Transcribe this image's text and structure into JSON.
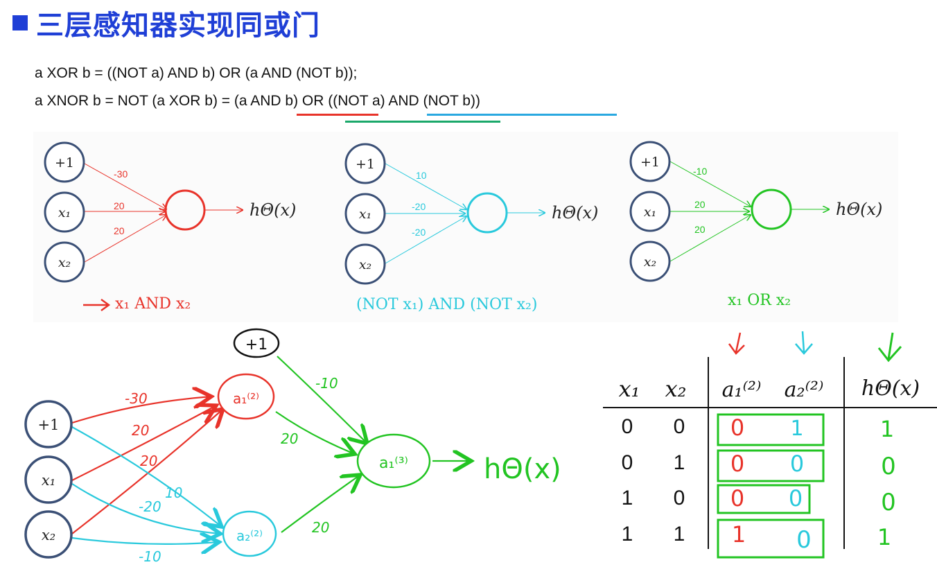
{
  "title": "三层感知器实现同或门",
  "equations": {
    "xor": "a XOR b = ((NOT a) AND b) OR (a AND (NOT b));",
    "xnor": "a XNOR b = NOT (a XOR b) = (a AND b) OR ((NOT a) AND (NOT b))"
  },
  "colors": {
    "title": "#1f3fd6",
    "red": "#e8332a",
    "cyan": "#29c9dc",
    "green": "#22c422",
    "node": "#3b5076"
  },
  "panels": [
    {
      "nodes": [
        "+1",
        "x₁",
        "x₂"
      ],
      "weights": [
        "-30",
        "20",
        "20"
      ],
      "output": "hΘ(x)",
      "caption": "x₁ AND x₂",
      "color": "#e8332a"
    },
    {
      "nodes": [
        "+1",
        "x₁",
        "x₂"
      ],
      "weights": [
        "10",
        "-20",
        "-20"
      ],
      "output": "hΘ(x)",
      "caption": "(NOT x₁) AND (NOT x₂)",
      "color": "#29c9dc"
    },
    {
      "nodes": [
        "+1",
        "x₁",
        "x₂"
      ],
      "weights": [
        "-10",
        "20",
        "20"
      ],
      "output": "hΘ(x)",
      "caption": "x₁ OR x₂",
      "color": "#22c422"
    }
  ],
  "network": {
    "inputs": [
      "+1",
      "x₁",
      "x₂"
    ],
    "bias_top": "+1",
    "hidden1": "a₁⁽²⁾",
    "hidden2": "a₂⁽²⁾",
    "output_node": "a₁⁽³⁾",
    "output_label": "hΘ(x)",
    "w_red": [
      "-30",
      "20",
      "20"
    ],
    "w_cyan": [
      "10",
      "-20",
      "-10"
    ],
    "w_green": [
      "-10",
      "20",
      "20"
    ]
  },
  "truth_table": {
    "headers": [
      "x₁",
      "x₂",
      "a₁⁽²⁾",
      "a₂⁽²⁾",
      "hΘ(x)"
    ],
    "rows": [
      [
        "0",
        "0",
        "0",
        "1",
        "1"
      ],
      [
        "0",
        "1",
        "0",
        "0",
        "0"
      ],
      [
        "1",
        "0",
        "0",
        "0",
        "0"
      ],
      [
        "1",
        "1",
        "1",
        "0",
        "1"
      ]
    ]
  }
}
